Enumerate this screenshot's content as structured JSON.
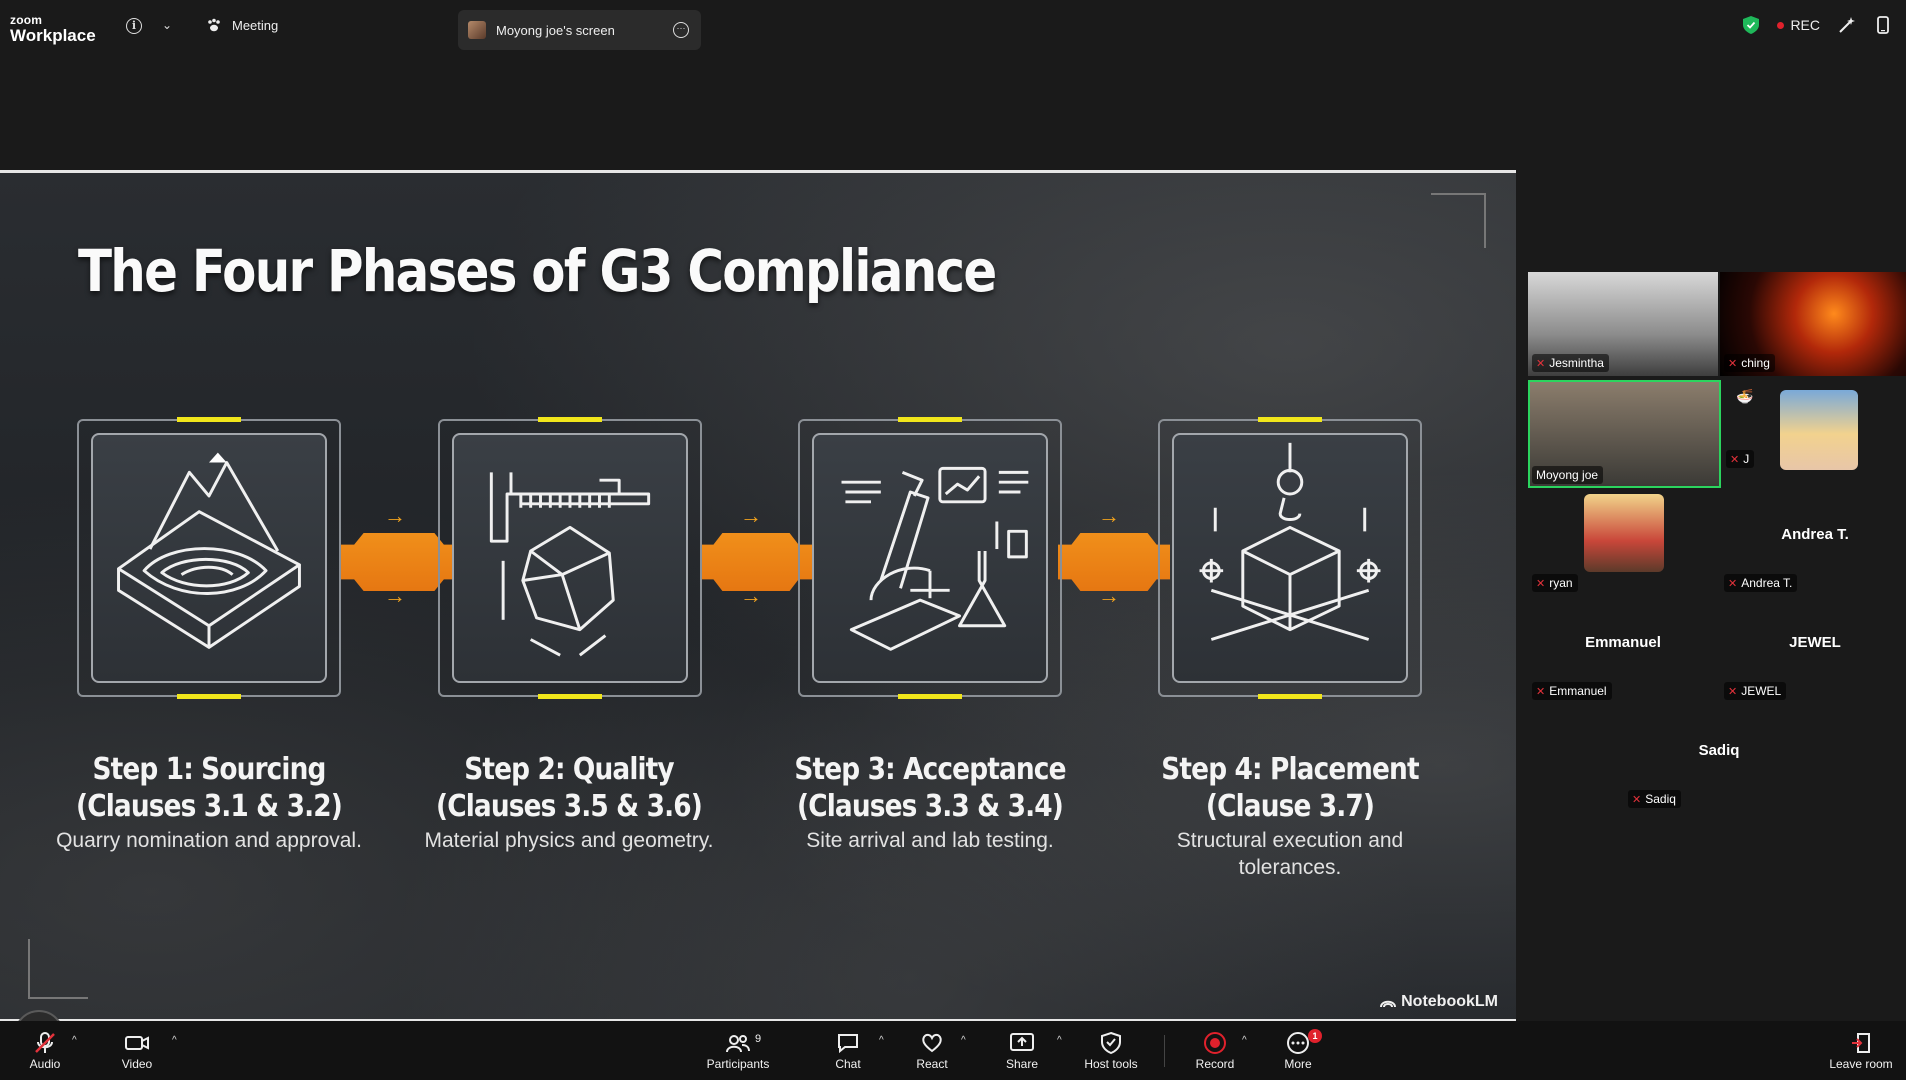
{
  "titlebar": {
    "brand_top": "zoom",
    "brand_bottom": "Workplace",
    "meeting_label": "Meeting",
    "tab_label": "Moyong joe's screen",
    "rec_label": "REC"
  },
  "slide": {
    "title": "The Four Phases of G3 Compliance",
    "steps": [
      {
        "title_line1": "Step 1: Sourcing",
        "title_line2": "(Clauses 3.1 & 3.2)",
        "desc": "Quarry nomination and approval."
      },
      {
        "title_line1": "Step 2: Quality",
        "title_line2": "(Clauses 3.5 & 3.6)",
        "desc": "Material physics and geometry."
      },
      {
        "title_line1": "Step 3: Acceptance",
        "title_line2": "(Clauses 3.3 & 3.4)",
        "desc": "Site arrival and lab testing."
      },
      {
        "title_line1": "Step 4: Placement",
        "title_line2": "(Clause 3.7)",
        "desc": "Structural execution and tolerances."
      }
    ],
    "watermark": "NotebookLM"
  },
  "gallery": {
    "tiles": [
      {
        "name": "Jesmintha",
        "muted": true
      },
      {
        "name": "ching",
        "muted": true
      },
      {
        "name": "Moyong joe",
        "muted": false,
        "active": true
      },
      {
        "name": "J",
        "muted": true
      },
      {
        "name": "ryan",
        "muted": true
      },
      {
        "name": "Andrea T.",
        "muted": true,
        "label": "Andrea T."
      },
      {
        "name": "Emmanuel",
        "muted": true,
        "label": "Emmanuel"
      },
      {
        "name": "JEWEL",
        "muted": true,
        "label": "JEWEL"
      },
      {
        "name": "Sadiq",
        "muted": true,
        "label": "Sadiq"
      }
    ]
  },
  "toolbar": {
    "audio": "Audio",
    "video": "Video",
    "participants": "Participants",
    "participants_count": "9",
    "chat": "Chat",
    "react": "React",
    "share": "Share",
    "host_tools": "Host tools",
    "record": "Record",
    "more": "More",
    "more_badge": "1",
    "leave": "Leave room"
  },
  "colors": {
    "accent_orange": "#f08f1a",
    "accent_yellow": "#f1e61b",
    "mute_red": "#e3323b",
    "active_green": "#2bd45e"
  }
}
